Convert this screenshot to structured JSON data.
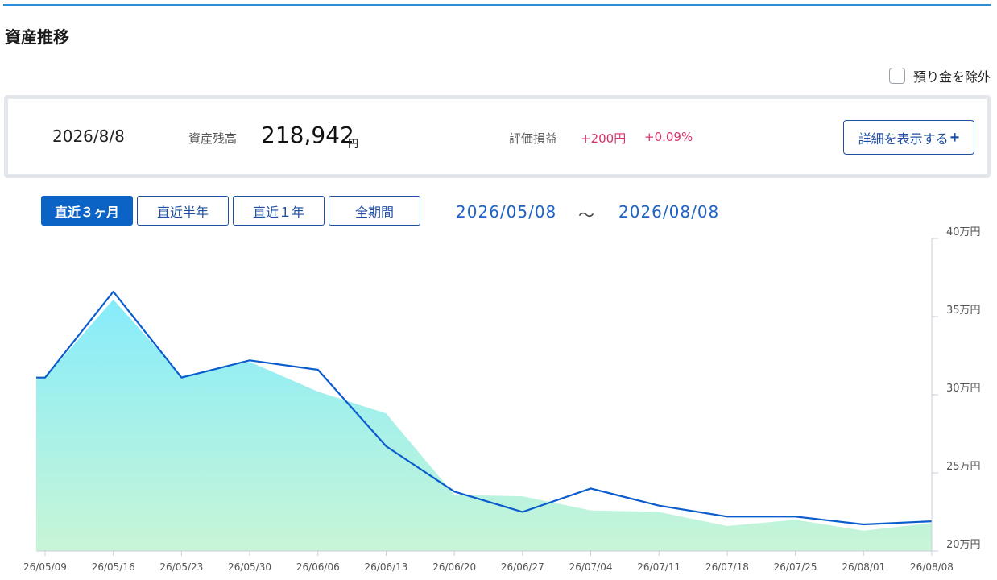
{
  "page_title": "資産推移",
  "exclude_deposits": {
    "label": "預り金を除外",
    "checked": false
  },
  "summary": {
    "date": "2026/8/8",
    "balance_label": "資産残高",
    "balance_value": "218,942",
    "balance_unit": "円",
    "pl_label": "評価損益",
    "pl_amount": "+200円",
    "pl_percent": "+0.09%",
    "detail_button": "詳細を表示する",
    "detail_icon": "plus-icon"
  },
  "period_tabs": [
    {
      "label": "直近３ヶ月",
      "active": true
    },
    {
      "label": "直近半年",
      "active": false
    },
    {
      "label": "直近１年",
      "active": false
    },
    {
      "label": "全期間",
      "active": false
    }
  ],
  "range": {
    "start": "2026/05/08",
    "separator": "～",
    "end": "2026/08/08"
  },
  "colors": {
    "accent": "#0b63c5",
    "gain": "#d6336c",
    "line": "#0b5ccc",
    "area_top": "#86ecfb",
    "area_bottom": "#c8f5d6"
  },
  "chart_data": {
    "type": "area",
    "x": [
      "26/05/08",
      "26/05/09",
      "26/05/16",
      "26/05/23",
      "26/05/30",
      "26/06/06",
      "26/06/13",
      "26/06/20",
      "26/06/27",
      "26/07/04",
      "26/07/11",
      "26/07/18",
      "26/07/25",
      "26/08/01",
      "26/08/08"
    ],
    "x_tick_labels": [
      "26/05/09",
      "26/05/16",
      "26/05/23",
      "26/05/30",
      "26/06/06",
      "26/06/13",
      "26/06/20",
      "26/06/27",
      "26/07/04",
      "26/07/11",
      "26/07/18",
      "26/07/25",
      "26/08/01",
      "26/08/08"
    ],
    "y_ticks": [
      20,
      25,
      30,
      35,
      40
    ],
    "y_tick_labels": [
      "20万円",
      "25万円",
      "30万円",
      "35万円",
      "40万円"
    ],
    "ylim": [
      20,
      40
    ],
    "series": [
      {
        "values": [
          31.1,
          31.1,
          36.6,
          31.1,
          32.2,
          31.6,
          26.7,
          23.8,
          22.5,
          24.0,
          22.9,
          22.2,
          22.2,
          21.7,
          21.9
        ]
      },
      {
        "values": [
          31.1,
          31.1,
          36.1,
          31.2,
          32.1,
          30.2,
          28.8,
          23.6,
          23.5,
          22.6,
          22.5,
          21.6,
          22.0,
          21.3,
          21.8
        ]
      }
    ],
    "grid": false
  }
}
